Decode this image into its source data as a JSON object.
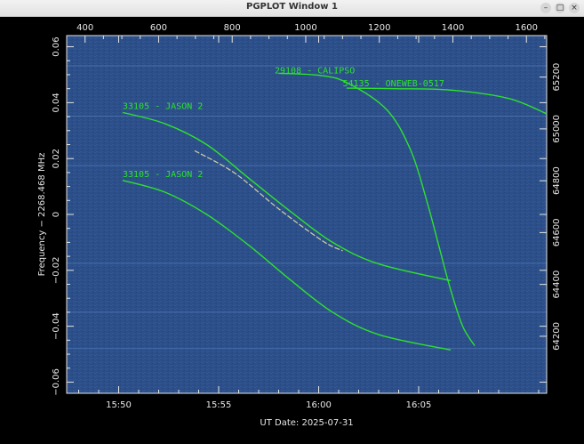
{
  "window": {
    "title": "PGPLOT Window 1",
    "controls": {
      "minimize": "–",
      "maximize": "□",
      "close": "×"
    }
  },
  "colors": {
    "background": "#000000",
    "plot_fill": "#2c4f8a",
    "trace": "#2ee12e",
    "axis": "#e6e6e6"
  },
  "chart_data": {
    "type": "line",
    "xlabel": "UT Date: 2025-07-31",
    "ylabel": "Frequency − 2268.468 MHz",
    "x_ticks": [
      "15:50",
      "15:55",
      "16:00",
      "16:05"
    ],
    "x_top_ticks": [
      "400",
      "600",
      "800",
      "1000",
      "1200",
      "1400",
      "1600"
    ],
    "y_ticks": [
      "0.06",
      "0.04",
      "0.02",
      "0",
      "−0.02",
      "−0.04",
      "−0.06"
    ],
    "y_right_ticks": [
      "65200",
      "65000",
      "64800",
      "64600",
      "64400",
      "64200"
    ],
    "xlim_minutes_after_1545": [
      2.4,
      26.4
    ],
    "ylim": [
      -0.064,
      0.064
    ],
    "top_xlim": [
      350,
      1655
    ],
    "right_ylim": [
      63980,
      65360
    ],
    "labels": [
      {
        "text": "29108 - CALIPSO",
        "x": 12.8,
        "y": 0.0505
      },
      {
        "text": "54135 - ONEWEB-0517",
        "x": 16.2,
        "y": 0.0458
      },
      {
        "text": "33105 - JASON 2",
        "x": 5.2,
        "y": 0.0378
      },
      {
        "text": "33105 - JASON 2",
        "x": 5.2,
        "y": 0.0133
      }
    ],
    "series": [
      {
        "points": [
          [
            5.2,
            0.0365
          ],
          [
            7.3,
            0.0325
          ],
          [
            9.4,
            0.025
          ],
          [
            11.5,
            0.013
          ],
          [
            13.6,
            0.001
          ],
          [
            15.7,
            -0.01
          ],
          [
            18.0,
            -0.0177
          ],
          [
            21.6,
            -0.0237
          ]
        ]
      },
      {
        "points": [
          [
            5.2,
            0.0122
          ],
          [
            7.3,
            0.008
          ],
          [
            9.4,
            0.0
          ],
          [
            11.5,
            -0.011
          ],
          [
            13.6,
            -0.0235
          ],
          [
            15.7,
            -0.035
          ],
          [
            18.0,
            -0.043
          ],
          [
            21.6,
            -0.0485
          ]
        ]
      },
      {
        "points": [
          [
            8.8,
            0.0228
          ],
          [
            10.8,
            0.0148
          ],
          [
            13.0,
            0.002
          ],
          [
            15.2,
            -0.0095
          ],
          [
            16.2,
            -0.013
          ]
        ]
      },
      {
        "points": [
          [
            13.0,
            0.0505
          ],
          [
            15.0,
            0.0498
          ],
          [
            16.4,
            0.0472
          ],
          [
            18.4,
            0.0375
          ],
          [
            19.6,
            0.023
          ],
          [
            20.4,
            0.005
          ],
          [
            21.0,
            -0.011
          ],
          [
            21.6,
            -0.027
          ],
          [
            22.2,
            -0.04
          ],
          [
            22.8,
            -0.047
          ]
        ]
      },
      {
        "points": [
          [
            16.4,
            0.0452
          ],
          [
            18.8,
            0.045
          ],
          [
            21.6,
            0.0445
          ],
          [
            24.5,
            0.0415
          ],
          [
            26.4,
            0.036
          ]
        ]
      }
    ],
    "grid": false
  }
}
